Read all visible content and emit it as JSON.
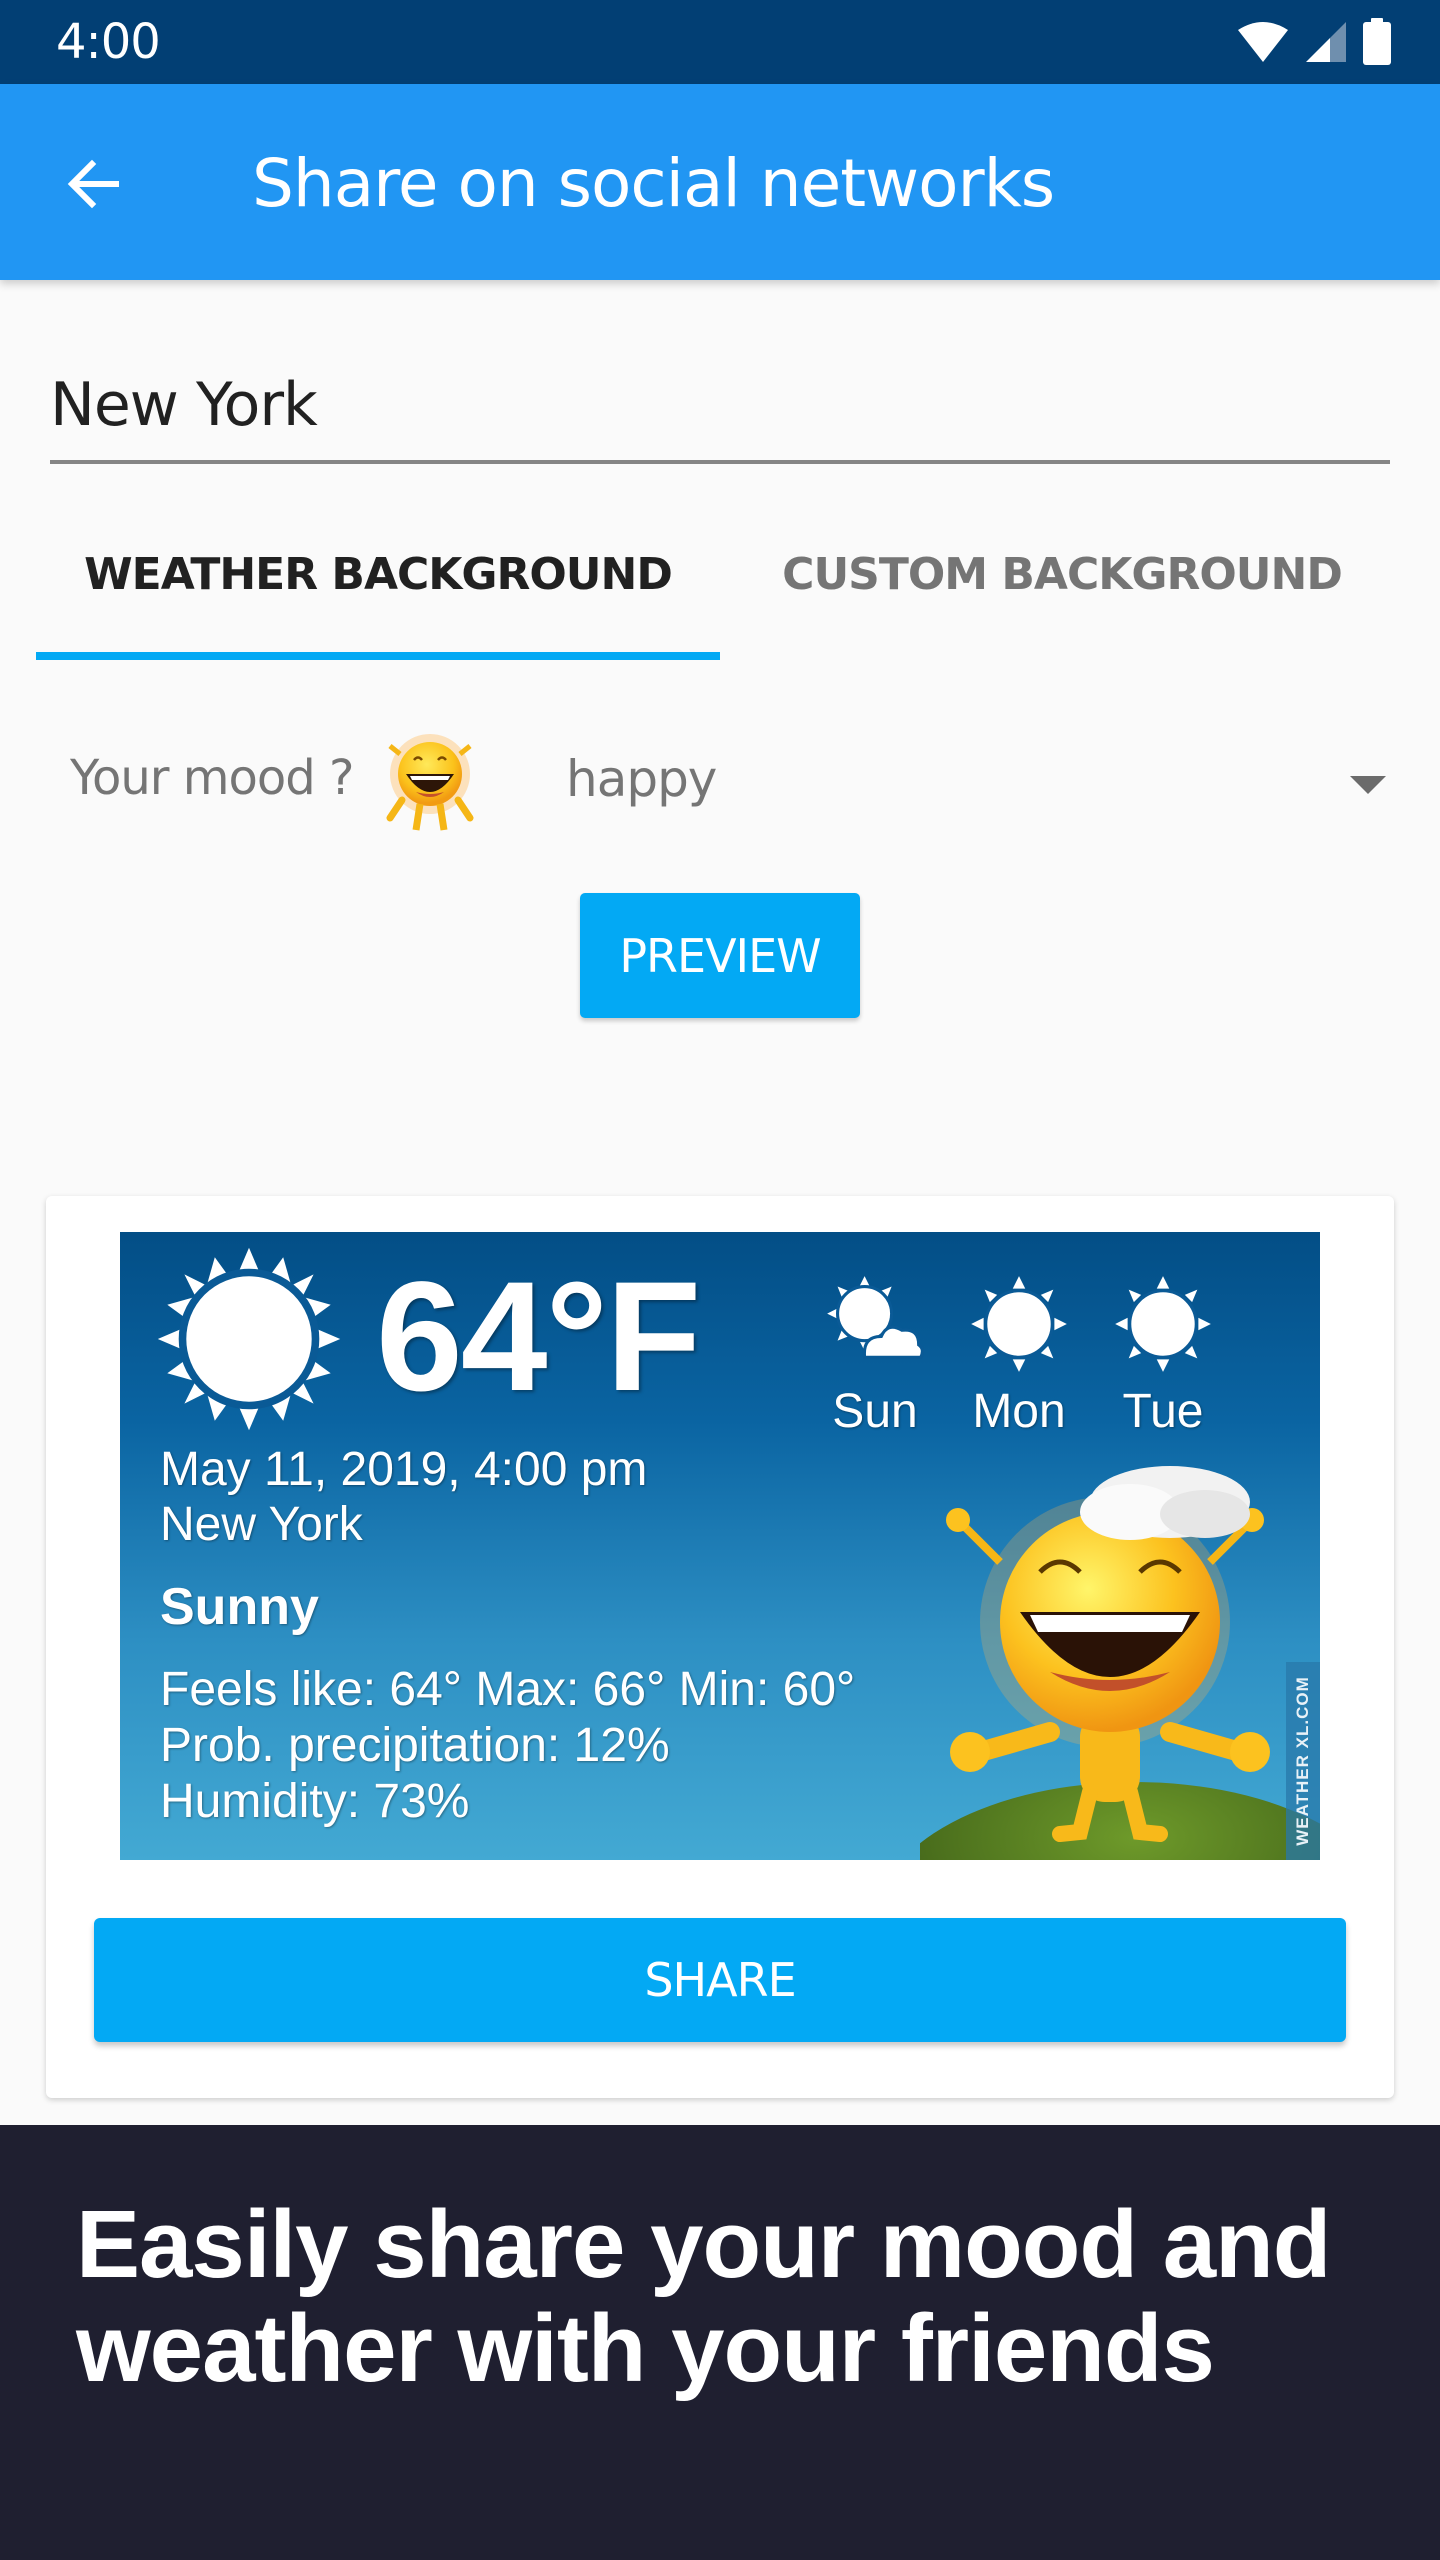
{
  "status_bar": {
    "time": "4:00",
    "icons": [
      "wifi-icon",
      "cellular-signal-icon",
      "battery-icon"
    ]
  },
  "app_bar": {
    "back_icon": "arrow-back-icon",
    "title": "Share on social networks"
  },
  "city_field": {
    "value": "New York",
    "placeholder": ""
  },
  "tabs": [
    {
      "label": "WEATHER BACKGROUND",
      "active": true
    },
    {
      "label": "CUSTOM BACKGROUND",
      "active": false
    }
  ],
  "mood": {
    "label": "Your mood ?",
    "emoji_icon": "laughing-sun-emoji-icon",
    "selected": "happy"
  },
  "buttons": {
    "preview": "PREVIEW",
    "share": "SHARE"
  },
  "weather_card": {
    "current_icon": "sun-icon",
    "temperature": "64°F",
    "datetime": "May 11, 2019, 4:00 pm",
    "city": "New York",
    "condition": "Sunny",
    "details": [
      "Feels like: 64° Max: 66° Min: 60°",
      "Prob. precipitation: 12%",
      "Humidity: 73%"
    ],
    "forecast": [
      {
        "day": "Sun",
        "icon": "partly-cloudy-icon"
      },
      {
        "day": "Mon",
        "icon": "sun-icon"
      },
      {
        "day": "Tue",
        "icon": "sun-icon"
      }
    ],
    "mascot": "laughing-sun-mascot",
    "brand": "WEATHER XL.COM"
  },
  "promo": {
    "headline": "Easily share your mood and weather with your friends"
  },
  "colors": {
    "status_bar": "#023f74",
    "app_bar": "#2196f3",
    "accent": "#03a9f4",
    "promo_bg": "#1f1f30",
    "page_bg": "#fafafa"
  }
}
